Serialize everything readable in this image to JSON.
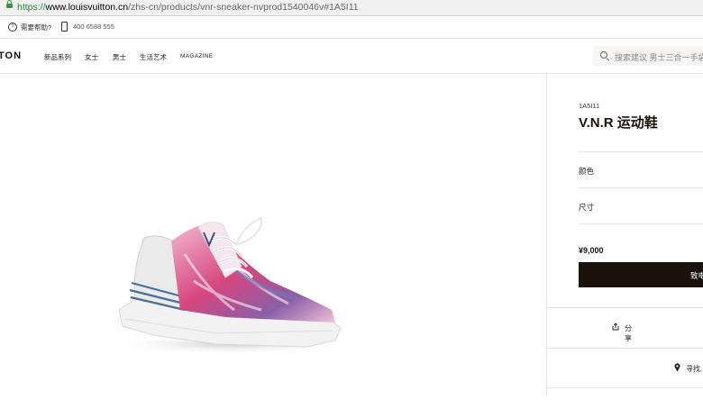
{
  "browser": {
    "url_scheme": "https://",
    "url_host": "www.louisvuitton.cn",
    "url_path": "/zhs-cn/products/vnr-sneaker-nvprod1540046v#1A5I11"
  },
  "helpbar": {
    "help_label": "需要帮助?",
    "phone": "400 6588 555"
  },
  "nav": {
    "logo": "TON",
    "items": [
      "新品系列",
      "女士",
      "男士",
      "生活艺术",
      "MAGAZINE"
    ],
    "active_index": 2,
    "search_placeholder": "搜索建议 男士三合一手袋"
  },
  "product": {
    "sku": "1A5I11",
    "title": "V.N.R 运动鞋",
    "color_label": "颜色",
    "size_label": "尺寸",
    "price": "¥9,000",
    "cta_label": "致电",
    "share_label": "分享",
    "find_label": "寻找..."
  },
  "colors": {
    "brand_dark": "#19110b",
    "secure_green": "#1f8a2e"
  }
}
